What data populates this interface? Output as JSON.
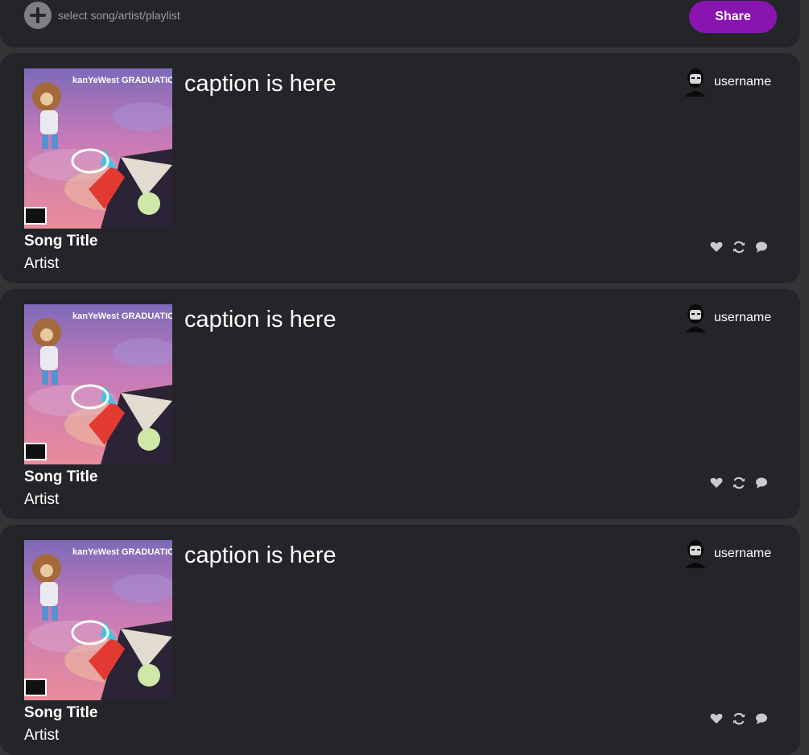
{
  "composer": {
    "placeholder": "select song/artist/playlist",
    "share_label": "Share",
    "add_icon": "plus-circle-icon",
    "accent_color": "#8a14b0"
  },
  "posts": [
    {
      "caption": "caption is here",
      "username": "username",
      "song_title": "Song Title",
      "artist": "Artist",
      "cover_text": "kanYeWest GRADUATION",
      "icons": [
        "heart-icon",
        "repost-icon",
        "comment-icon"
      ]
    },
    {
      "caption": "caption is here",
      "username": "username",
      "song_title": "Song Title",
      "artist": "Artist",
      "cover_text": "kanYeWest GRADUATION",
      "icons": [
        "heart-icon",
        "repost-icon",
        "comment-icon"
      ]
    },
    {
      "caption": "caption is here",
      "username": "username",
      "song_title": "Song Title",
      "artist": "Artist",
      "cover_text": "kanYeWest GRADUATION",
      "icons": [
        "heart-icon",
        "repost-icon",
        "comment-icon"
      ]
    }
  ]
}
